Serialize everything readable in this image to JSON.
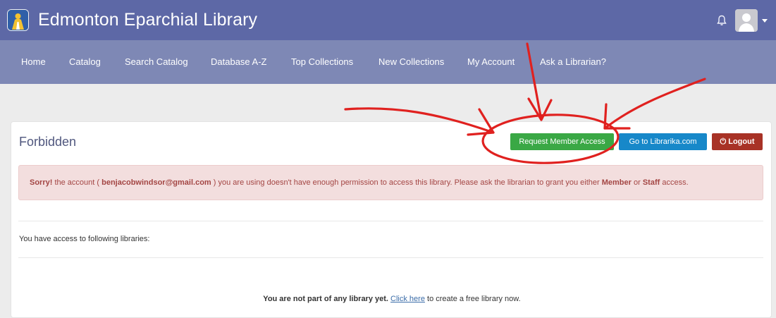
{
  "header": {
    "title": "Edmonton Eparchial Library",
    "logo_icon": "library-logo-icon",
    "bell_icon": "bell-icon",
    "avatar_icon": "user-avatar-icon",
    "colors": {
      "header_bg": "#5d68a6",
      "nav_bg": "#7e88b5"
    }
  },
  "nav": {
    "items": [
      {
        "label": "Home"
      },
      {
        "label": "Catalog"
      },
      {
        "label": "Search Catalog"
      },
      {
        "label": "Database A-Z"
      },
      {
        "label": "Top Collections"
      },
      {
        "label": "New Collections"
      },
      {
        "label": "My Account"
      },
      {
        "label": "Ask a Librarian?"
      }
    ]
  },
  "card": {
    "title": "Forbidden",
    "buttons": {
      "request": "Request Member Access",
      "librarika": "Go to Librarika.com",
      "logout": "Logout",
      "logout_icon": "power-icon"
    },
    "alert": {
      "prefix": "Sorry!",
      "before_email": " the account ( ",
      "email": "benjacobwindsor@gmail.com",
      "after_email": " ) you are using doesn't have enough permission to access this library. Please ask the librarian to grant you either ",
      "role_member": "Member",
      "or": " or ",
      "role_staff": "Staff",
      "suffix": " access."
    },
    "access_label": "You have access to following libraries:",
    "bottom": {
      "bold": "You are not part of any library yet",
      "period": ". ",
      "link": "Click here",
      "rest": " to create a free library now."
    },
    "colors": {
      "request": "#3aa845",
      "librarika": "#1788c9",
      "logout": "#a83226",
      "alert_bg": "#f3dede",
      "alert_text": "#a34543"
    }
  }
}
